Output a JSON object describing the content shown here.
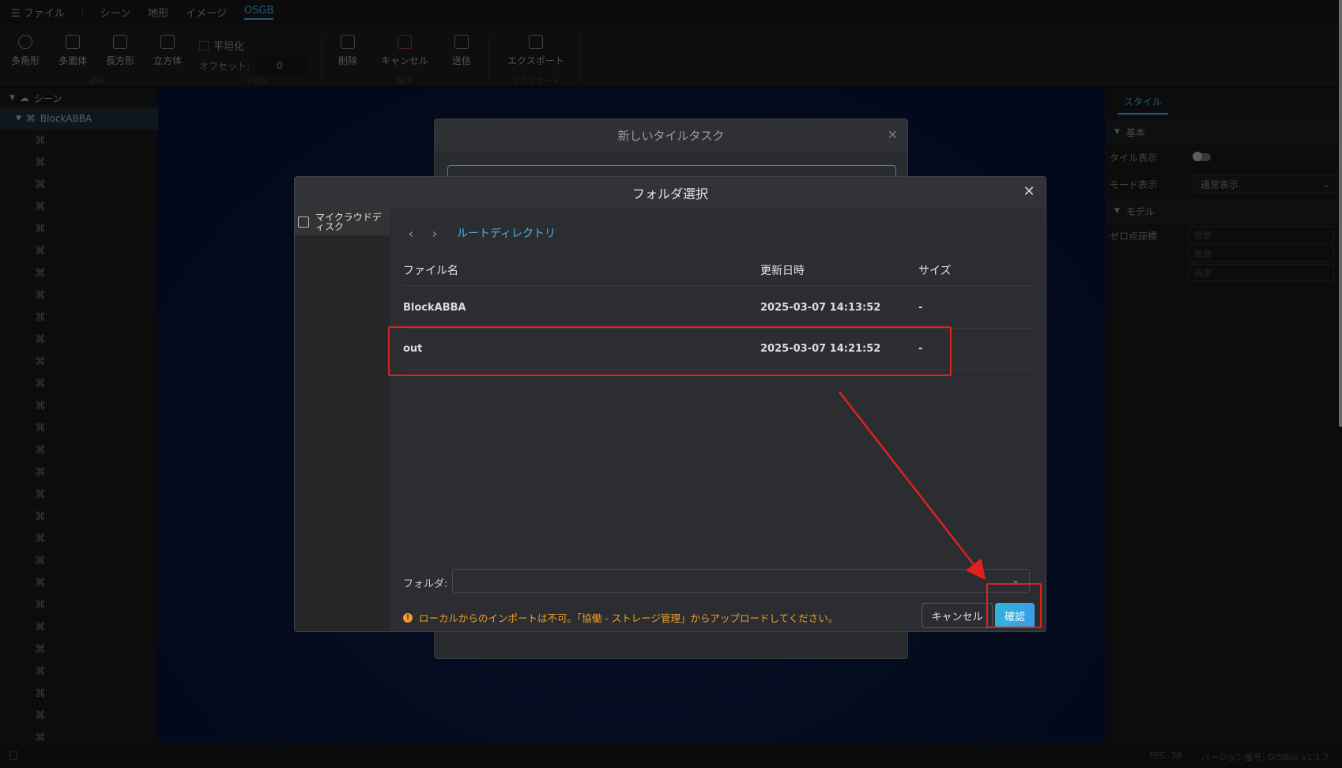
{
  "menubar": {
    "file": "☰ ファイル",
    "items": [
      "シーン",
      "地形",
      "イメージ",
      "OSGB"
    ]
  },
  "ribbon": {
    "polygon": "多角形",
    "polyhedron": "多面体",
    "rectangle": "長方形",
    "cube": "立方体",
    "flatten": "平坦化",
    "offset_label": "オフセット:",
    "offset_value": "0",
    "delete": "削除",
    "cancel": "キャンセル",
    "send": "送信",
    "export": "エクスポート",
    "groups": [
      "選択",
      "平坦化",
      "操作",
      "エクスポート"
    ]
  },
  "tree": {
    "root": "シーン",
    "node": "BlockABBA"
  },
  "style_panel": {
    "tab": "スタイル",
    "section_basic": "基本",
    "tile_display": "タイル表示",
    "mode_display": "モード表示",
    "mode_value": "通常表示",
    "section_model": "モデル",
    "zero_coord": "ゼロ点座標",
    "lon": "経度",
    "lat": "緯度",
    "alt": "高度"
  },
  "statusbar": {
    "fps": "FPS: 38",
    "version": "バージョン番号: GISBox v1.1.7"
  },
  "back_dialog": {
    "title": "新しいタイルタスク"
  },
  "dialog": {
    "title": "フォルダ選択",
    "side_item": "マイクラウドディスク",
    "breadcrumb": "ルートディレクトリ",
    "columns": {
      "name": "ファイル名",
      "modified": "更新日時",
      "size": "サイズ"
    },
    "rows": [
      {
        "name": "BlockABBA",
        "modified": "2025-03-07 14:13:52",
        "size": "-"
      },
      {
        "name": "out",
        "modified": "2025-03-07 14:21:52",
        "size": "-"
      }
    ],
    "folder_label": "フォルダ:",
    "folder_value": "",
    "warning": "ローカルからのインポートは不可。「協働 - ストレージ管理」からアップロードしてください。",
    "cancel": "キャンセル",
    "confirm": "確認"
  },
  "colors": {
    "accent": "#3aa0d8",
    "annotation": "#e0211e",
    "warning": "#f0a028"
  }
}
